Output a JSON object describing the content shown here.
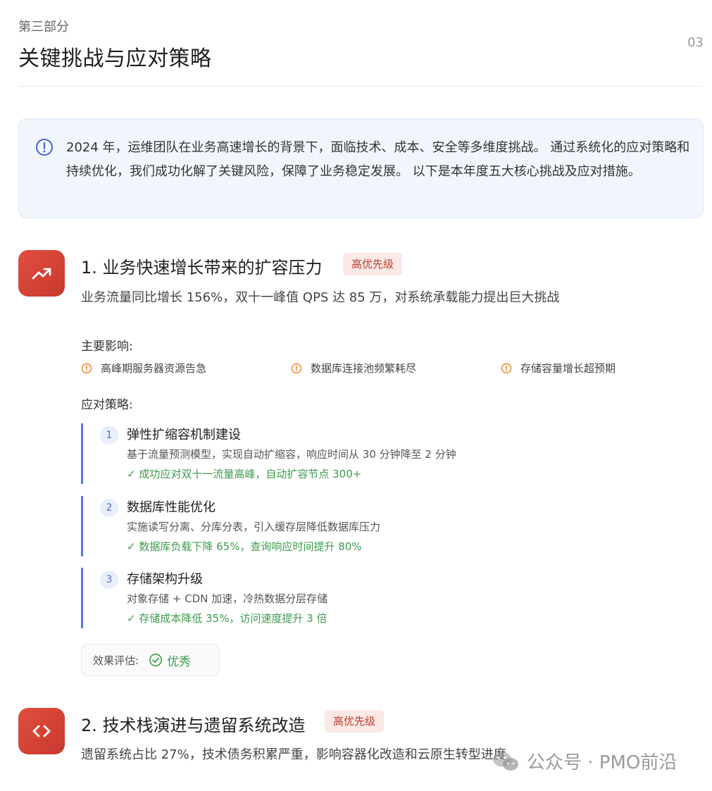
{
  "header": {
    "section_label": "第三部分",
    "title": "关键挑战与应对策略",
    "page_number": "03"
  },
  "intro": {
    "icon": "info-circle-icon",
    "text": "2024 年，运维团队在业务高速增长的背景下，面临技术、成本、安全等多维度挑战。 通过系统化的应对策略和持续优化，我们成功化解了关键风险，保障了业务稳定发展。 以下是本年度五大核心挑战及应对措施。"
  },
  "challenges": [
    {
      "icon": "trending-up-icon",
      "title": "1. 业务快速增长带来的扩容压力",
      "priority": "高优先级",
      "description": "业务流量同比增长 156%，双十一峰值 QPS 达 85 万，对系统承载能力提出巨大挑战",
      "impacts_heading": "主要影响:",
      "impacts": [
        "高峰期服务器资源告急",
        "数据库连接池频繁耗尽",
        "存储容量增长超预期"
      ],
      "strategies_heading": "应对策略:",
      "strategies": [
        {
          "number": "1",
          "title": "弹性扩缩容机制建设",
          "detail": "基于流量预测模型，实现自动扩缩容，响应时间从 30 分钟降至 2 分钟",
          "result": "✓ 成功应对双十一流量高峰，自动扩容节点 300+"
        },
        {
          "number": "2",
          "title": "数据库性能优化",
          "detail": "实施读写分离、分库分表，引入缓存层降低数据库压力",
          "result": "✓ 数据库负载下降 65%，查询响应时间提升 80%"
        },
        {
          "number": "3",
          "title": "存储架构升级",
          "detail": "对象存储 + CDN 加速，冷热数据分层存储",
          "result": "✓ 存储成本降低 35%，访问速度提升 3 倍"
        }
      ],
      "evaluation_label": "效果评估:",
      "evaluation_value": "优秀"
    },
    {
      "icon": "code-brackets-icon",
      "title": "2. 技术栈演进与遗留系统改造",
      "priority": "高优先级",
      "description": "遗留系统占比 27%，技术债务积累严重，影响容器化改造和云原生转型进度"
    }
  ],
  "watermark": {
    "text": "公众号 · PMO前沿"
  },
  "colors": {
    "accent_red": "#d9443a",
    "badge_bg": "#fbe9e6",
    "strategy_bar": "#5b78e0",
    "success_green": "#3f9a4c",
    "impact_orange": "#e8892b",
    "intro_bg": "#f1f6fd"
  }
}
